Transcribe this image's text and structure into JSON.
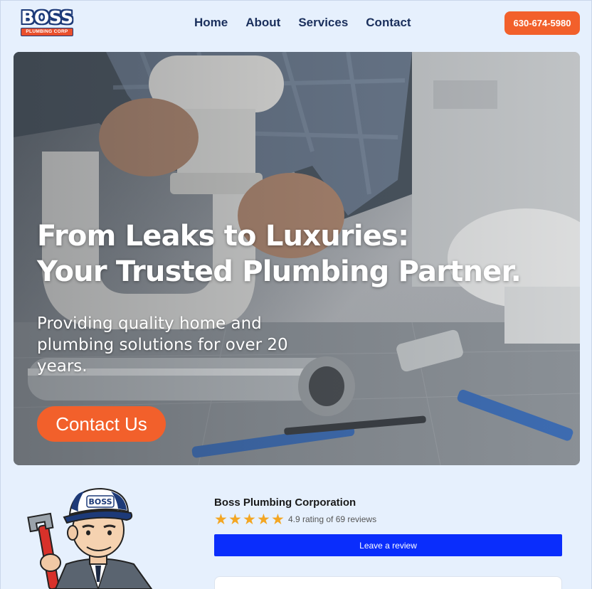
{
  "header": {
    "logo": {
      "top": "BOSS",
      "bottom": "PLUMBING CORP"
    },
    "nav": [
      {
        "label": "Home"
      },
      {
        "label": "About"
      },
      {
        "label": "Services"
      },
      {
        "label": "Contact"
      }
    ],
    "phone": "630-674-5980"
  },
  "hero": {
    "title_line1": "From Leaks to Luxuries:",
    "title_line2": "Your Trusted Plumbing Partner.",
    "subtitle": "Providing quality home and plumbing solutions for over 20 years.",
    "cta": "Contact Us"
  },
  "mascot": {
    "cap_text": "BOSS"
  },
  "review": {
    "business_name": "Boss Plumbing Corporation",
    "stars": 5,
    "rating_text": "4.9 rating of 69 reviews",
    "button": "Leave a review"
  },
  "colors": {
    "accent": "#f2602b",
    "nav_text": "#1a2f5c",
    "review_button": "#0a2dfc",
    "background": "#e6f0fd",
    "star": "#f3a623"
  }
}
